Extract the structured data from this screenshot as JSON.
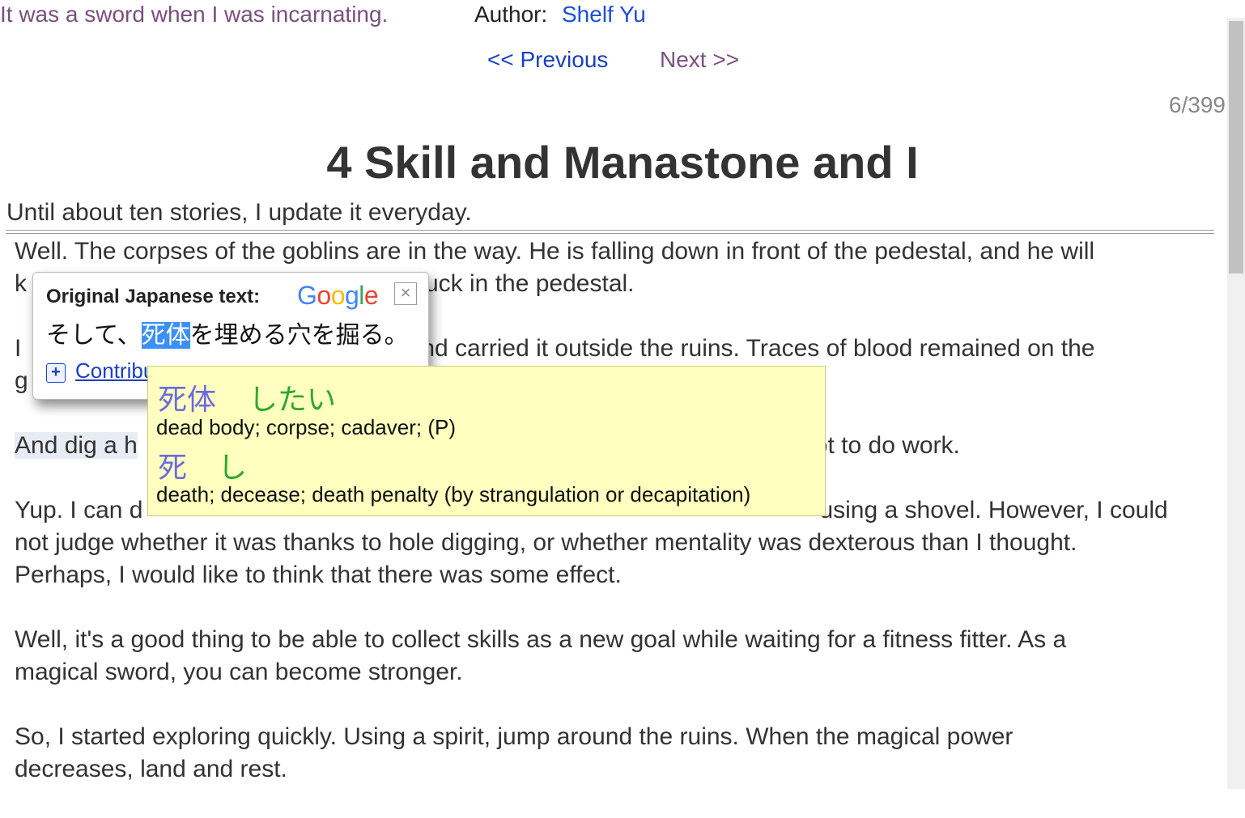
{
  "header": {
    "series_title": "It was a sword when I was incarnating.",
    "author_label": "Author:",
    "author_name": "Shelf Yu"
  },
  "nav": {
    "previous": "<< Previous",
    "next": "Next >>",
    "page_count": "6/399"
  },
  "chapter": {
    "title": "4 Skill and Manastone and I",
    "preface": "Until about ten stories, I update it everyday."
  },
  "body": {
    "p1_line1": "Well. The corpses of the goblins are in the way. He is falling down in front of the pedestal, and he will",
    "p1_line2_start": "k",
    "p1_line2_end": "uck in the pedestal.",
    "p2_line1_start": "I",
    "p2_line1_end": "nd carried it outside the ruins. Traces of blood remained on the",
    "p2_line2_start": "g",
    "p3_start": "And dig a h",
    "p3_end": "ot to do work.",
    "p4_line1_start": "Yup. I can d",
    "p4_line1_end": "using a shovel. However, I could",
    "p4_line2": "not judge whether it was thanks to hole digging, or whether mentality was dexterous than I thought.",
    "p4_line3": "Perhaps, I would like to think that there was some effect.",
    "p5_line1": "Well, it's a good thing to be able to collect skills as a new goal while waiting for a fitness fitter. As a",
    "p5_line2": "magical sword, you can become stronger.",
    "p6_line1": "So, I started exploring quickly. Using a spirit, jump around the ruins. When the magical power",
    "p6_line2": "decreases, land and rest."
  },
  "translate_popup": {
    "heading": "Original Japanese text:",
    "logo": [
      "G",
      "o",
      "o",
      "g",
      "l",
      "e"
    ],
    "logo_colors": [
      "#4285f4",
      "#ea4335",
      "#fbbc05",
      "#4285f4",
      "#34a853",
      "#ea4335"
    ],
    "close_glyph": "×",
    "original_before": "そして、",
    "original_selected": "死体",
    "original_after": "を埋める穴を掘る。",
    "contribute_plus": "+",
    "contribute_label": "Contribu"
  },
  "dictionary_popup": {
    "entries": [
      {
        "word": "死体",
        "reading": "したい",
        "definition": "dead body; corpse; cadaver; (P)"
      },
      {
        "word": "死",
        "reading": "し",
        "definition": "death; decease; death penalty (by strangulation or decapitation)"
      }
    ]
  },
  "colors": {
    "visited_link": "#7a4f80",
    "link": "#1a4fd6",
    "selection": "#3b8ff5",
    "dict_background": "#ffffbf",
    "dict_word": "#6a6ae0",
    "dict_reading": "#2ea82e"
  }
}
